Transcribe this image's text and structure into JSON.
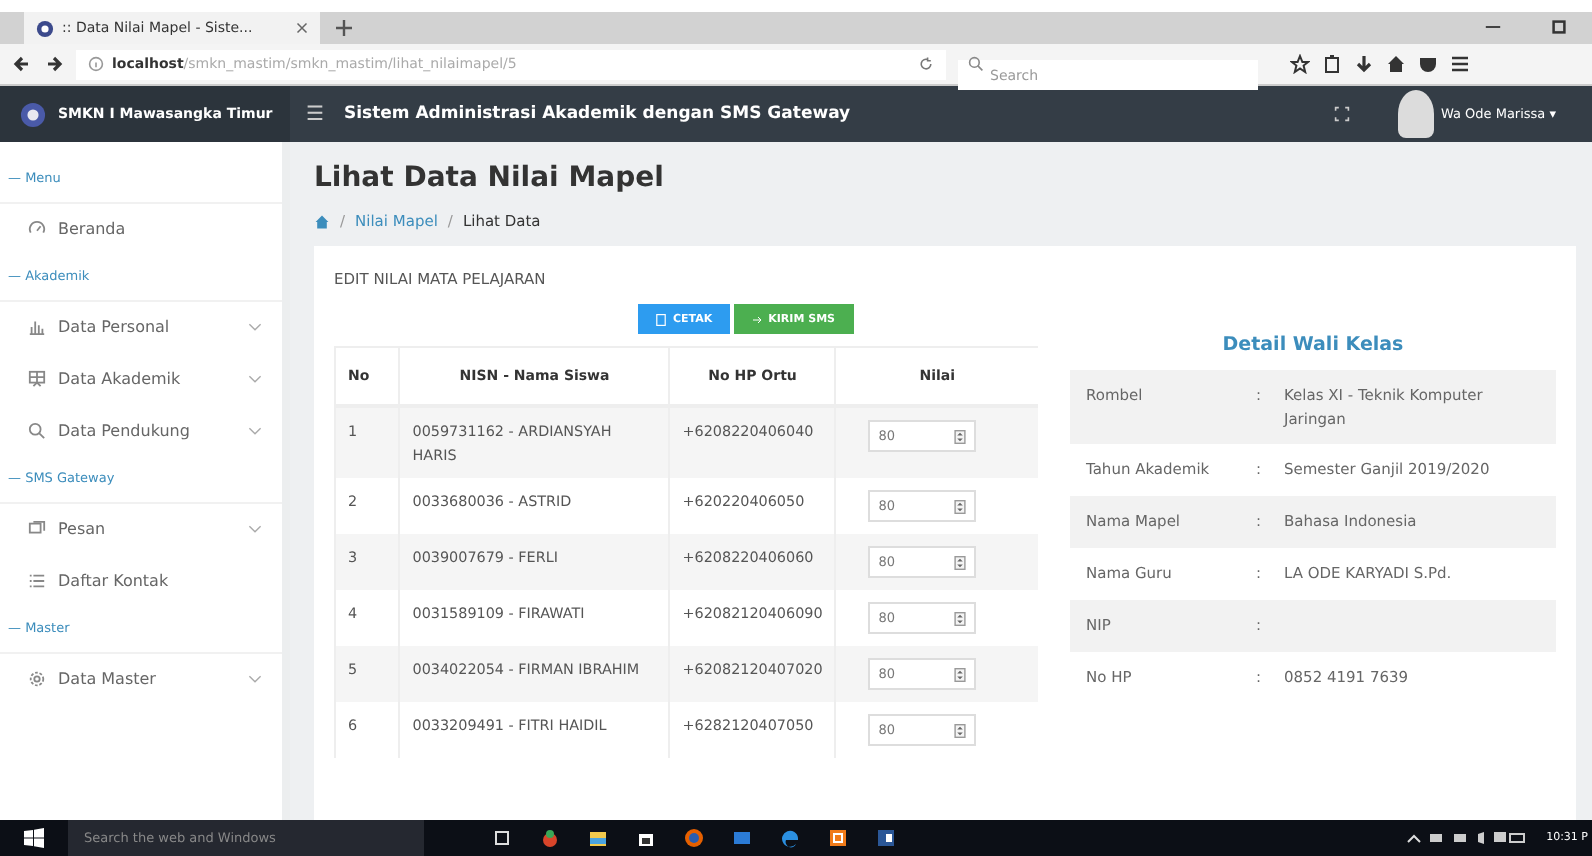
{
  "browser": {
    "tab_title": ":: Data Nilai Mapel - Siste...",
    "url_host": "localhost",
    "url_path": "/smkn_mastim/smkn_mastim/lihat_nilaimapel/5",
    "search_placeholder": "Search"
  },
  "header": {
    "brand": "SMKN I Mawasangka Timur",
    "menu_glyph": "☰",
    "title": "Sistem Administrasi Akademik dengan SMS Gateway",
    "user": "Wa Ode Marissa ▾"
  },
  "sidebar": {
    "sections": [
      {
        "label": "— Menu",
        "items": [
          {
            "label": "Beranda",
            "expandable": false
          }
        ]
      },
      {
        "label": "— Akademik",
        "items": [
          {
            "label": "Data Personal",
            "expandable": true
          },
          {
            "label": "Data Akademik",
            "expandable": true
          },
          {
            "label": "Data Pendukung",
            "expandable": true
          }
        ]
      },
      {
        "label": "— SMS Gateway",
        "items": [
          {
            "label": "Pesan",
            "expandable": true
          },
          {
            "label": "Daftar Kontak",
            "expandable": false
          }
        ]
      },
      {
        "label": "— Master",
        "items": [
          {
            "label": "Data Master",
            "expandable": true
          }
        ]
      }
    ]
  },
  "page": {
    "title": "Lihat Data Nilai Mapel",
    "breadcrumb": [
      {
        "sep": "/",
        "label": "Nilai Mapel",
        "link": true
      },
      {
        "sep": "/",
        "label": "Lihat Data",
        "link": false
      }
    ]
  },
  "card": {
    "heading": "EDIT NILAI MATA PELAJARAN",
    "buttons": [
      {
        "label": "CETAK",
        "kind": "print"
      },
      {
        "label": "KIRIM SMS",
        "kind": "send"
      }
    ],
    "table": {
      "columns": [
        "No",
        "NISN - Nama Siswa",
        "No HP Ortu",
        "Nilai"
      ],
      "rows": [
        {
          "no": "1",
          "siswa": "0059731162 - ARDIANSYAH HARIS",
          "hp": "+6208220406040",
          "nilai": "80"
        },
        {
          "no": "2",
          "siswa": "0033680036 - ASTRID",
          "hp": "+620220406050",
          "nilai": "80"
        },
        {
          "no": "3",
          "siswa": "0039007679 - FERLI",
          "hp": "+6208220406060",
          "nilai": "80"
        },
        {
          "no": "4",
          "siswa": "0031589109 - FIRAWATI",
          "hp": "+62082120406090",
          "nilai": "80"
        },
        {
          "no": "5",
          "siswa": "0034022054 - FIRMAN IBRAHIM",
          "hp": "+62082120407020",
          "nilai": "80"
        },
        {
          "no": "6",
          "siswa": "0033209491 - FITRI HAIDIL",
          "hp": "+6282120407050",
          "nilai": "80"
        }
      ]
    },
    "detail": {
      "title": "Detail Wali Kelas",
      "rows": [
        {
          "label": "Rombel",
          "sep": ":",
          "value": "Kelas XI - Teknik Komputer Jaringan"
        },
        {
          "label": "Tahun Akademik",
          "sep": ":",
          "value": "Semester Ganjil 2019/2020"
        },
        {
          "label": "Nama Mapel",
          "sep": ":",
          "value": "Bahasa Indonesia"
        },
        {
          "label": "Nama Guru",
          "sep": ":",
          "value": "LA ODE KARYADI S.Pd."
        },
        {
          "label": "NIP",
          "sep": ":"
        },
        {
          "label": "No HP",
          "sep": ":",
          "value": "0852 4191 7639"
        }
      ]
    }
  },
  "taskbar": {
    "search_placeholder": "Search the web and Windows",
    "time": "10:31 P"
  }
}
